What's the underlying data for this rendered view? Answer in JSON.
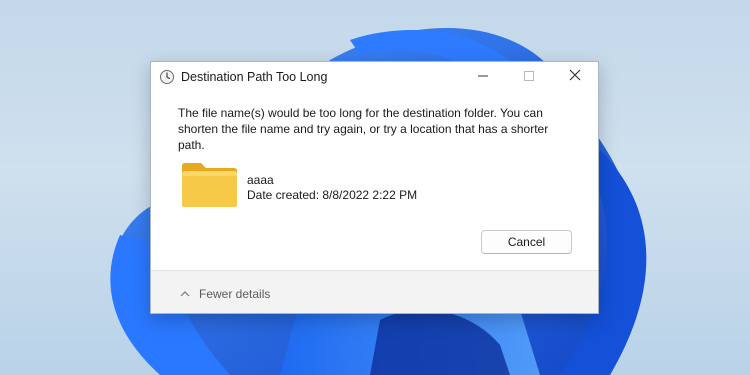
{
  "dialog": {
    "title": "Destination Path Too Long",
    "message": "The file name(s) would be too long for the destination folder. You can shorten the file name and try again, or try a location that has a shorter path.",
    "file": {
      "name": "aaaa",
      "date_created": "Date created: 8/8/2022 2:22 PM"
    },
    "cancel_label": "Cancel",
    "details_toggle_label": "Fewer details"
  },
  "colors": {
    "wallpaper_blue": "#1f5fe0",
    "folder_yellow": "#f7c948",
    "footer_bg": "#f3f3f3"
  },
  "icons": {
    "title": "clock-icon",
    "folder": "folder-icon",
    "minimize": "minimize-icon",
    "maximize": "maximize-icon",
    "close": "close-icon",
    "toggle": "chevron-up-icon"
  }
}
